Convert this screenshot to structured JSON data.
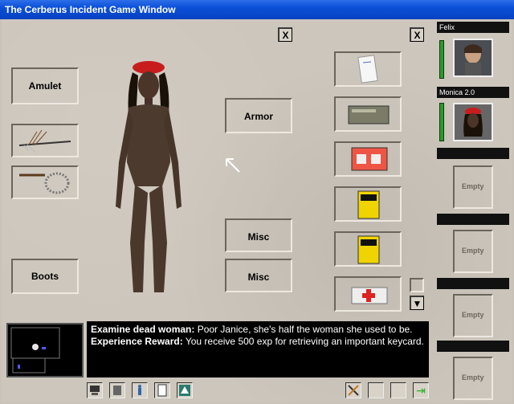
{
  "window": {
    "title": "The Cerberus Incident Game Window"
  },
  "slots": {
    "amulet": "Amulet",
    "boots": "Boots",
    "armor": "Armor",
    "misc1": "Misc",
    "misc2": "Misc"
  },
  "close_labels": {
    "left": "X",
    "right": "X"
  },
  "party": [
    {
      "name": "Felix"
    },
    {
      "name": "Monica 2.0"
    }
  ],
  "empty_slots": [
    "Empty",
    "Empty",
    "Empty",
    "Empty"
  ],
  "messages": [
    {
      "title": "Examine dead woman:",
      "text": " Poor Janice, she's half the woman she used to be."
    },
    {
      "title": "Experience Reward:",
      "text": " You receive 500 exp for retrieving an important keycard."
    }
  ],
  "icons": {
    "scroll_down": "▼",
    "exit": "⇥"
  },
  "colors": {
    "title_bar": "#0a4fd8",
    "health": "#2c9a2c"
  }
}
